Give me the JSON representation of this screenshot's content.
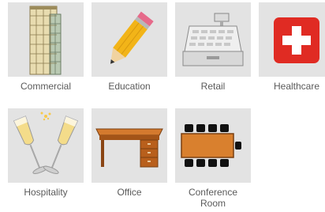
{
  "categories": [
    {
      "label": "Commercial",
      "icon": "office-building-icon"
    },
    {
      "label": "Education",
      "icon": "pencil-icon"
    },
    {
      "label": "Retail",
      "icon": "cash-register-icon"
    },
    {
      "label": "Healthcare",
      "icon": "medical-cross-icon"
    },
    {
      "label": "Hospitality",
      "icon": "champagne-toast-icon"
    },
    {
      "label": "Office",
      "icon": "desk-icon"
    },
    {
      "label": "Conference Room",
      "icon": "conference-table-icon"
    }
  ],
  "colors": {
    "tile_background": "#e3e3e3",
    "label_text": "#5a5a5a",
    "healthcare_red": "#e02b23"
  }
}
